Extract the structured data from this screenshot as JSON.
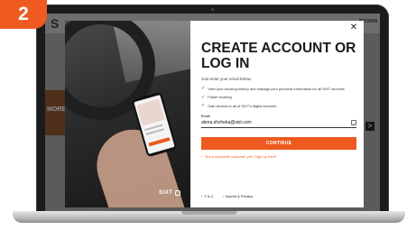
{
  "step": "2",
  "site": {
    "logo": "S",
    "book_label": "BOOKIN",
    "more_label": "MORE",
    "arrow": ">"
  },
  "photo": {
    "brand": "SIXT"
  },
  "modal": {
    "close_glyph": "✕",
    "title": "CREATE ACCOUNT OR LOG IN",
    "subtitle": "Just enter your email below.",
    "benefits": [
      "View your booking history and manage your personal information for all SIXT services",
      "Faster booking",
      "Gain access to all of SIXT's digital services"
    ],
    "email_label": "Email",
    "email_value": "alena.shcheka@sixt.com",
    "continue_label": "CONTINUE",
    "signup_text": "Not a corporate customer yet? Sign up here!",
    "footer": [
      "T & C",
      "Imprint & Privacy"
    ]
  },
  "colors": {
    "accent": "#ee5a1f"
  }
}
